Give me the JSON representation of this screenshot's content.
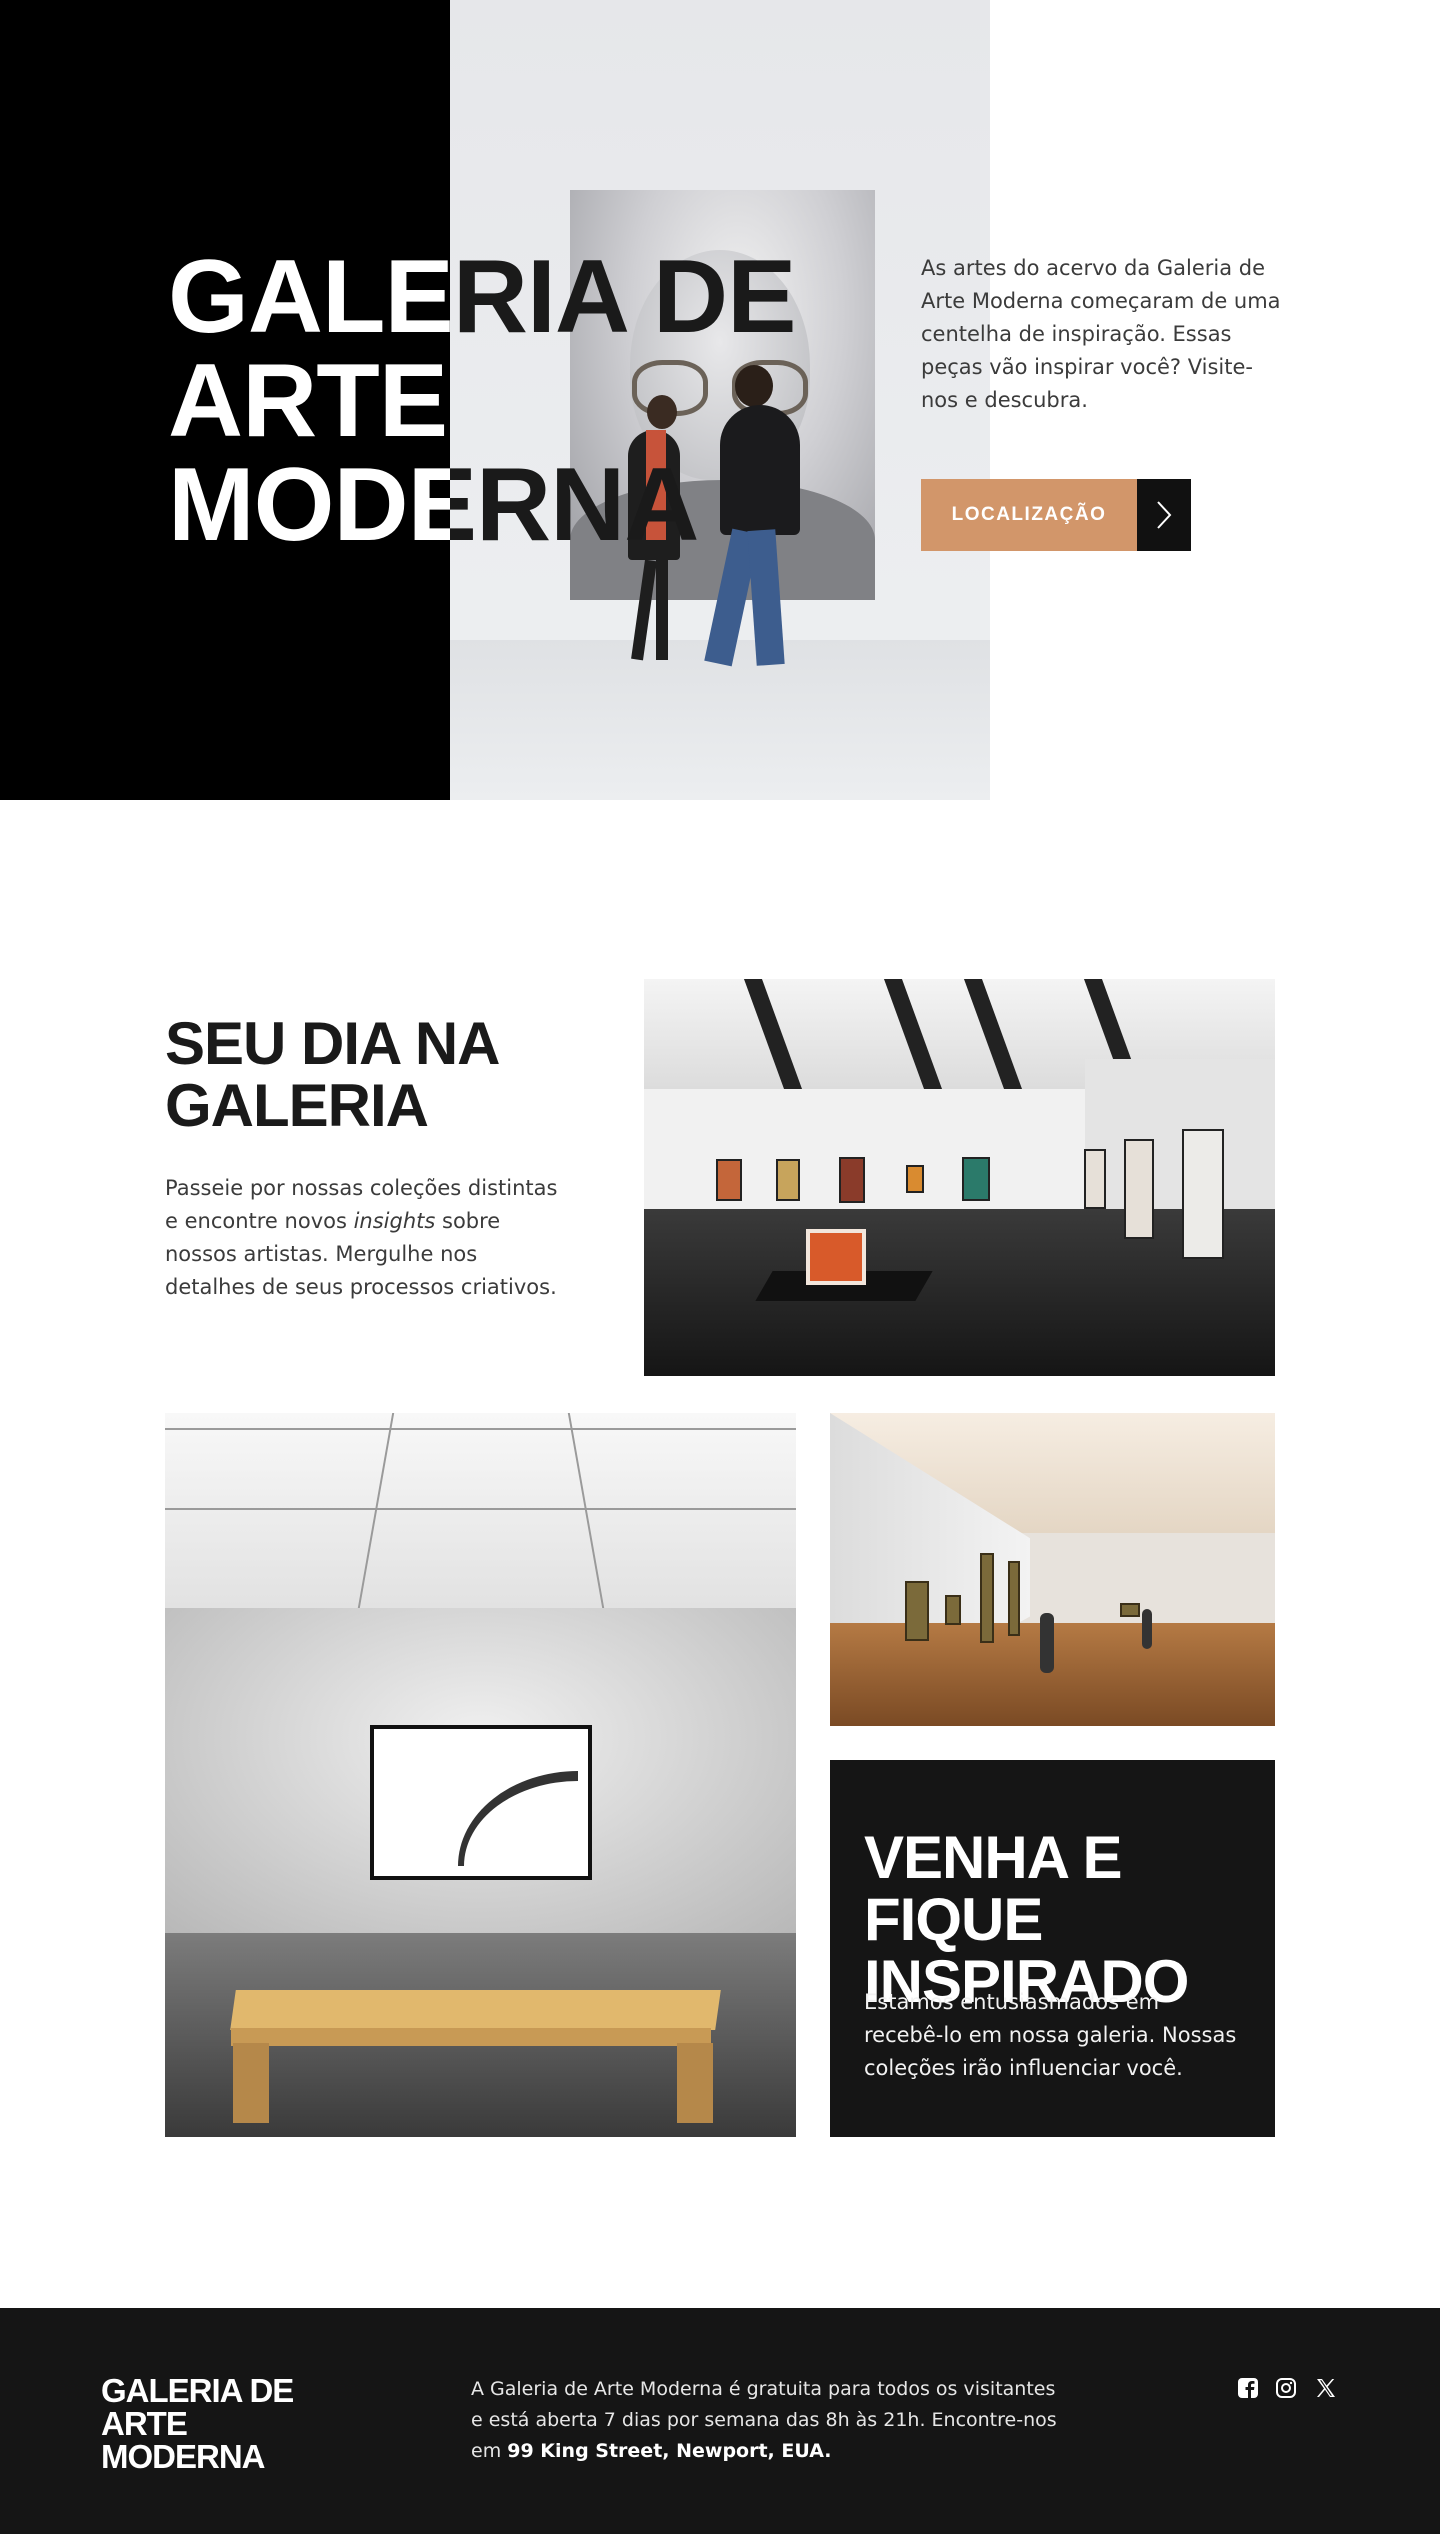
{
  "hero": {
    "title_lines": [
      "GALERIA DE",
      "ARTE",
      "MODERNA"
    ],
    "description": "As artes do acervo da Galeria de Arte Moderna começaram de uma centelha de inspiração. Essas peças vão inspirar você? Visite-nos e descubra.",
    "cta_label": "LOCALIZAÇÃO",
    "cta_icon": "chevron-right-icon"
  },
  "section_day": {
    "title_lines": [
      "SEU DIA NA",
      "GALERIA"
    ],
    "text_before": "Passeie por nossas coleções distintas e encontre novos ",
    "text_emphasis": "insights",
    "text_after": " sobre nossos artistas. Mergulhe nos detalhes de seus processos criativos."
  },
  "card": {
    "title_lines": [
      "VENHA E FIQUE",
      "INSPIRADO"
    ],
    "body": "Estamos entusiasmados em recebê-lo em nossa galeria. Nossas coleções irão influenciar você."
  },
  "footer": {
    "logo_lines": [
      "GALERIA DE ARTE",
      "MODERNA"
    ],
    "text": "A Galeria de Arte Moderna é gratuita para todos os visitantes e está aberta 7 dias por semana das 8h às 21h. Encontre-nos em ",
    "address": "99 King Street, Newport, EUA.",
    "social": [
      "facebook-icon",
      "instagram-icon",
      "x-icon"
    ]
  },
  "colors": {
    "accent": "#d2966a",
    "dark": "#151515",
    "hero_black": "#000000"
  }
}
